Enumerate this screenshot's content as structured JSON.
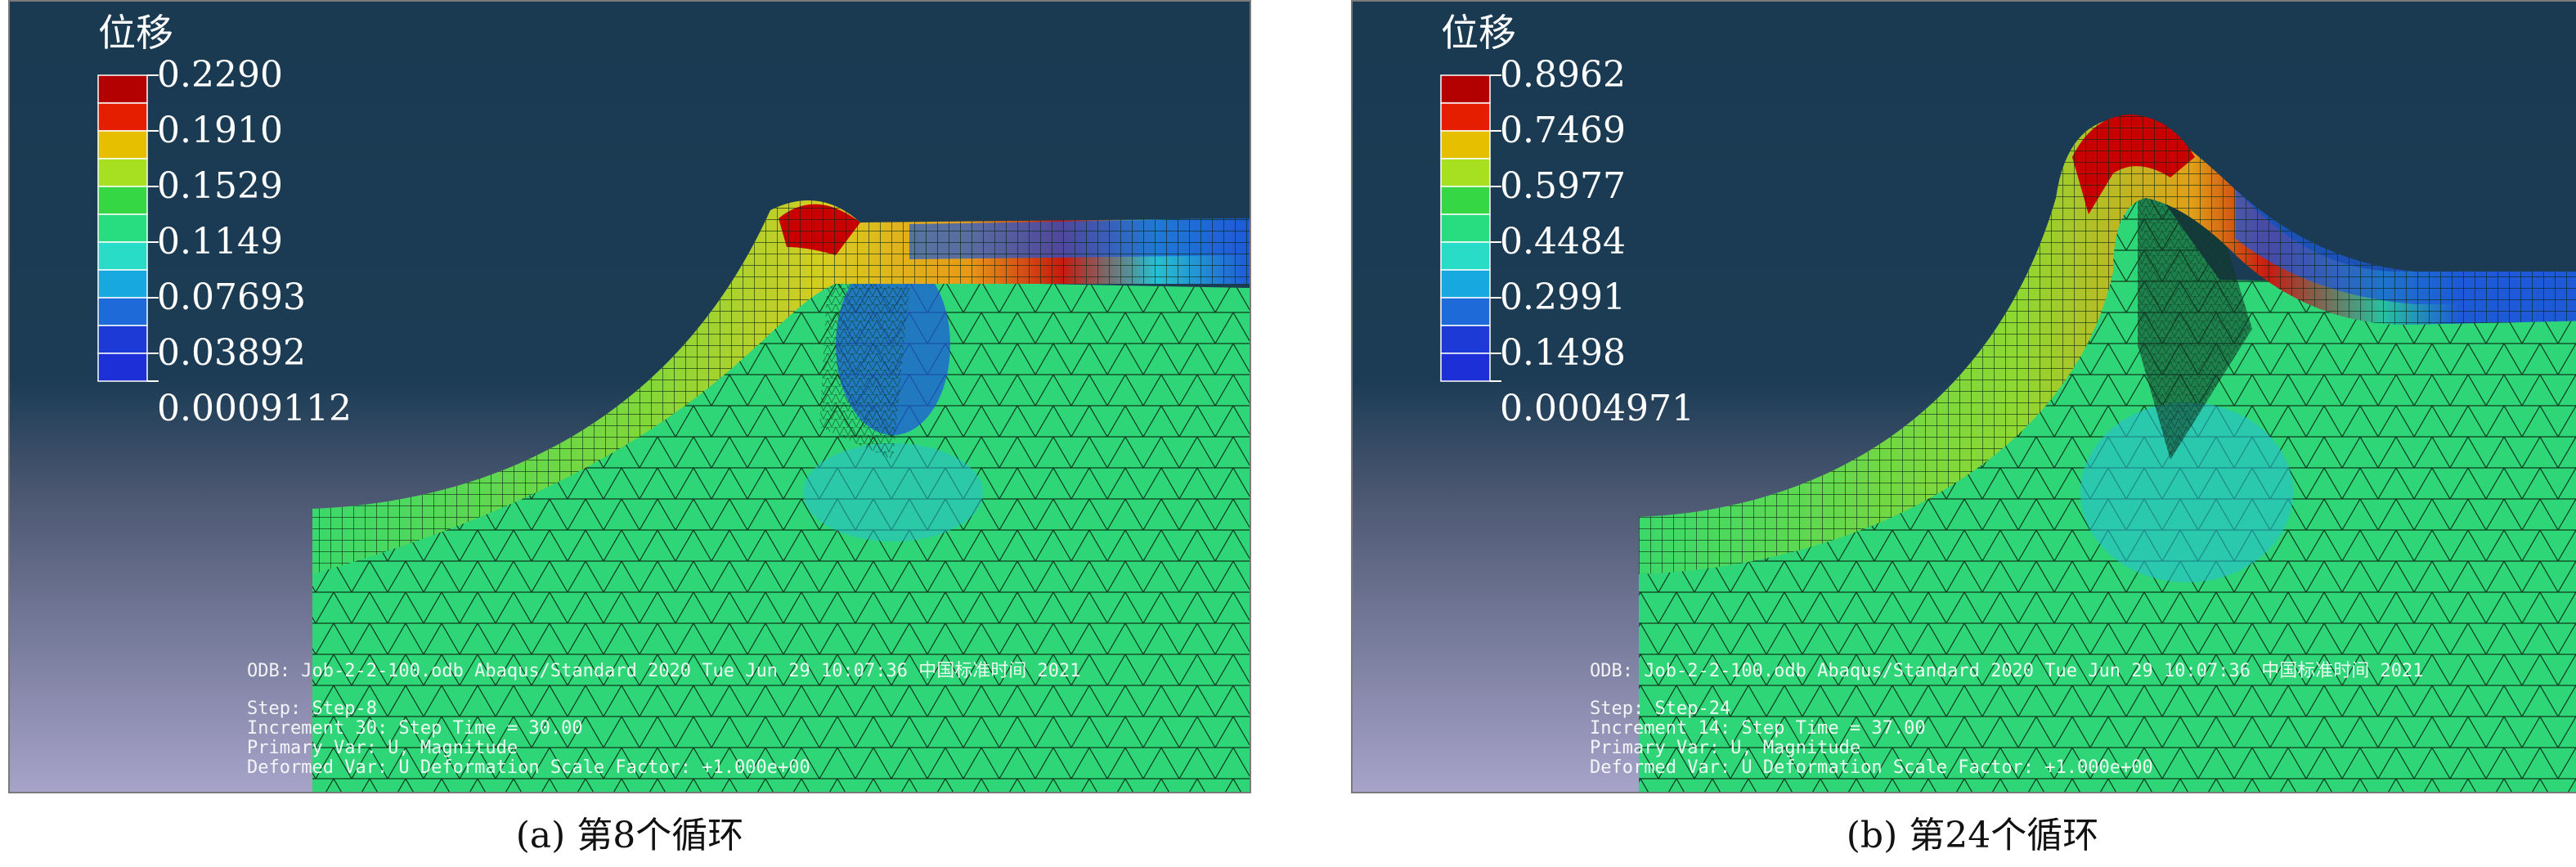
{
  "colors": {
    "background_dark": "#1a3a52",
    "mesh_green": "#2fd678",
    "mesh_line": "#0a2a14",
    "contour_low": "#1f4ad8",
    "contour_high": "#c80000"
  },
  "contour_colors": [
    "#b30000",
    "#e61e00",
    "#e6c000",
    "#a6e020",
    "#35d844",
    "#28dca0",
    "#18a8e0",
    "#1d5ad8",
    "#1d2fd6"
  ],
  "panels": [
    {
      "legend_title": "位移",
      "legend_values": [
        "0.2290",
        "0.1910",
        "0.1529",
        "0.1149",
        "0.07693",
        "0.03892",
        "0.0009112"
      ],
      "info_lines": [
        "ODB: Job-2-2-100.odb    Abaqus/Standard 2020    Tue Jun 29 10:07:36 中国标准时间 2021",
        "Step: Step-8",
        "Increment    30: Step Time =    30.00",
        "Primary Var: U, Magnitude",
        "Deformed Var: U   Deformation Scale Factor: +1.000e+00"
      ],
      "caption": "(a) 第8个循环"
    },
    {
      "legend_title": "位移",
      "legend_values": [
        "0.8962",
        "0.7469",
        "0.5977",
        "0.4484",
        "0.2991",
        "0.1498",
        "0.0004971"
      ],
      "info_lines": [
        "ODB: Job-2-2-100.odb    Abaqus/Standard 2020    Tue Jun 29 10:07:36 中国标准时间 2021",
        "Step: Step-24",
        "Increment    14: Step Time =    37.00",
        "Primary Var: U, Magnitude",
        "Deformed Var: U   Deformation Scale Factor: +1.000e+00"
      ],
      "caption": "(b) 第24个循环"
    }
  ]
}
